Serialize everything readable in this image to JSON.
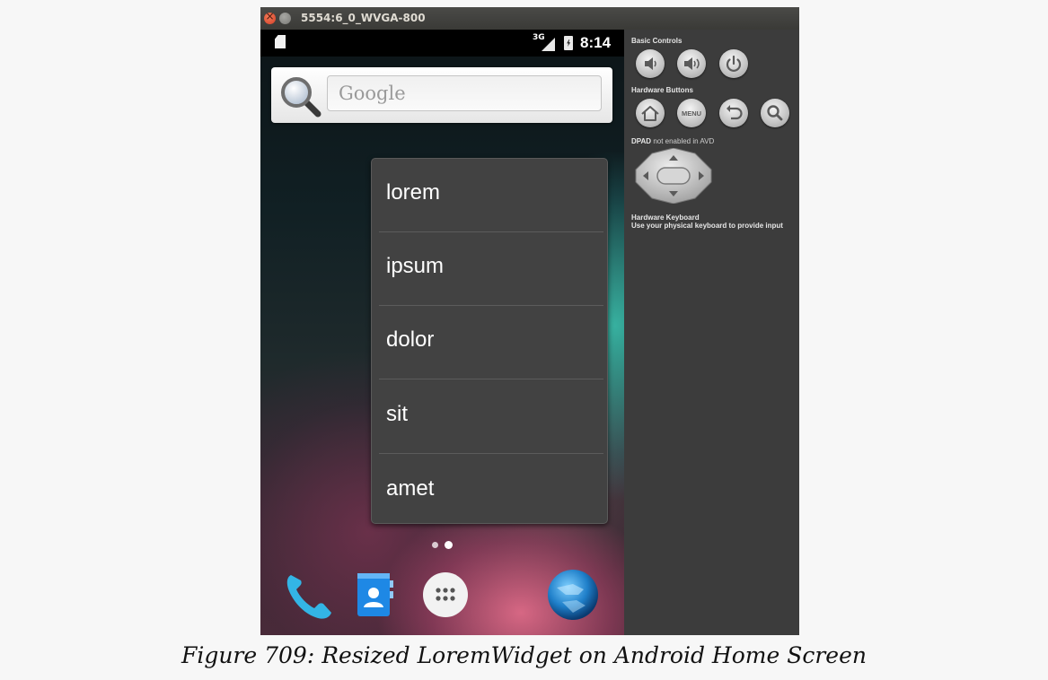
{
  "window": {
    "title": "5554:6_0_WVGA-800"
  },
  "status_bar": {
    "network": "3G",
    "time": "8:14",
    "icons": [
      "sd-card-icon",
      "signal-icon",
      "battery-charging-icon"
    ]
  },
  "search": {
    "placeholder": "Google",
    "icon": "magnifier-icon"
  },
  "widget": {
    "items": [
      "lorem",
      "ipsum",
      "dolor",
      "sit",
      "amet"
    ]
  },
  "home": {
    "pages": 2,
    "current_page": 2,
    "dock": [
      "phone-icon",
      "contacts-icon",
      "app-drawer-icon",
      "browser-globe-icon"
    ]
  },
  "controls": {
    "basic_controls_label": "Basic Controls",
    "basic_controls": [
      "volume-down-icon",
      "volume-up-icon",
      "power-icon"
    ],
    "hardware_buttons_label": "Hardware Buttons",
    "hardware_buttons": [
      "home-icon",
      "menu-icon",
      "back-icon",
      "search-icon"
    ],
    "menu_label": "MENU",
    "dpad_label": "DPAD",
    "dpad_note": "not enabled in AVD",
    "keyboard_label": "Hardware Keyboard",
    "keyboard_note": "Use your physical keyboard to provide input"
  },
  "caption": "Figure 709: Resized LoremWidget on Android Home Screen",
  "colors": {
    "widget_background": "#424242",
    "panel_background": "#3c3c3c",
    "close_button": "#e0502e"
  }
}
